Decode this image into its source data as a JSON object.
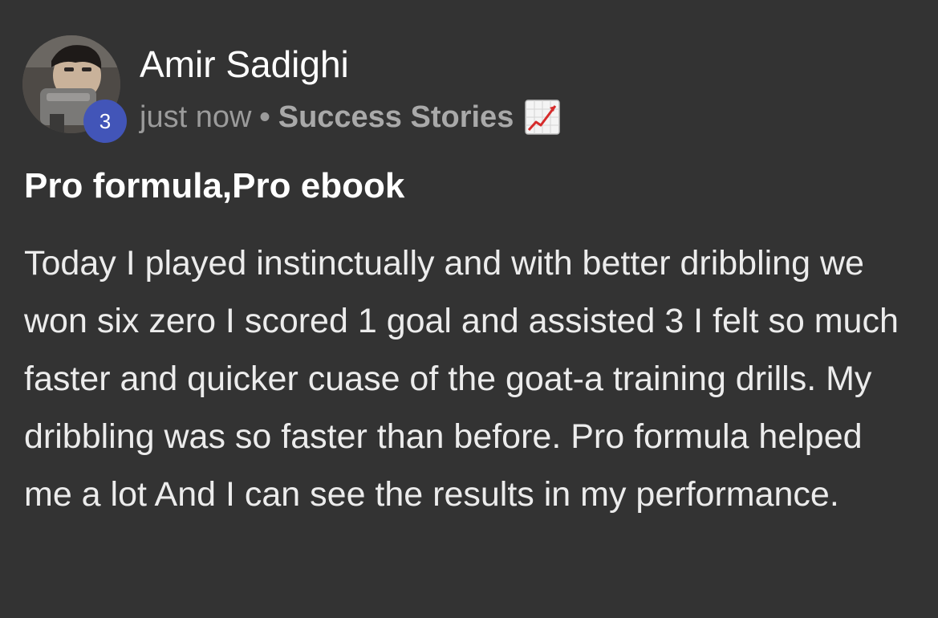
{
  "post": {
    "author": {
      "name": "Amir Sadighi",
      "level": "3",
      "avatar_icon": "user-avatar-photo"
    },
    "meta": {
      "time": "just now",
      "separator": "•",
      "category": "Success Stories",
      "category_icon": "chart-increasing-icon"
    },
    "title": "Pro formula,Pro ebook",
    "body": "Today I played instinctually and with better dribbling we won six zero I scored 1 goal and assisted 3 I felt so much faster and quicker cuase of the goat-a training drills. My dribbling was so faster than before. Pro formula helped me a lot And I can see the results in my performance."
  },
  "colors": {
    "background": "#333333",
    "badge": "#4255b8",
    "meta_text": "#9b9b9b",
    "body_text": "#ececec"
  }
}
